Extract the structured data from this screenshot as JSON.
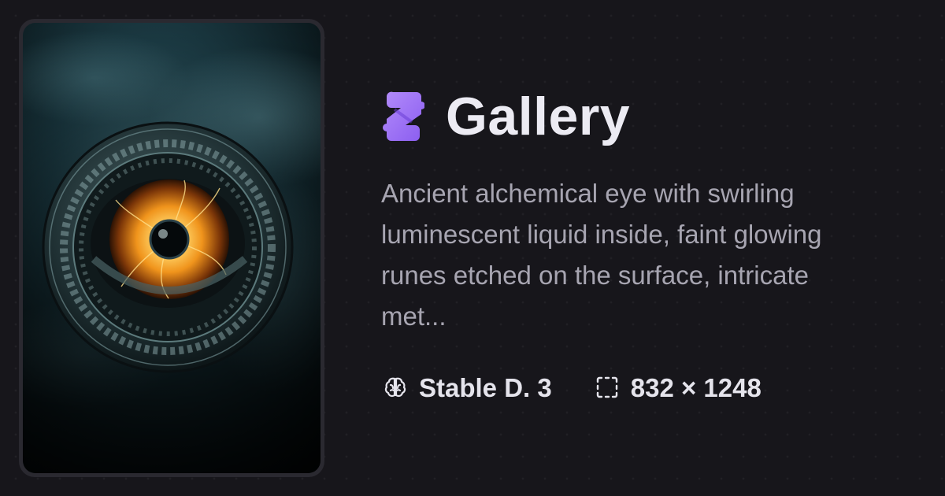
{
  "preview": {
    "image_alt": "Ancient alchemical eye artwork"
  },
  "header": {
    "logo_icon": "puzzle-s-icon",
    "title": "Gallery"
  },
  "description": "Ancient alchemical eye with swirling luminescent liquid inside, faint glowing runes etched on the surface, intricate met...",
  "meta": {
    "model": {
      "icon": "brain-icon",
      "label": "Stable D. 3"
    },
    "dimensions": {
      "icon": "dashed-frame-icon",
      "label": "832 × 1248"
    }
  },
  "colors": {
    "background": "#17161b",
    "accent": "#a175f4",
    "title": "#ecebf3",
    "description": "#a7a5b1",
    "meta_text": "#e5e4ec"
  }
}
